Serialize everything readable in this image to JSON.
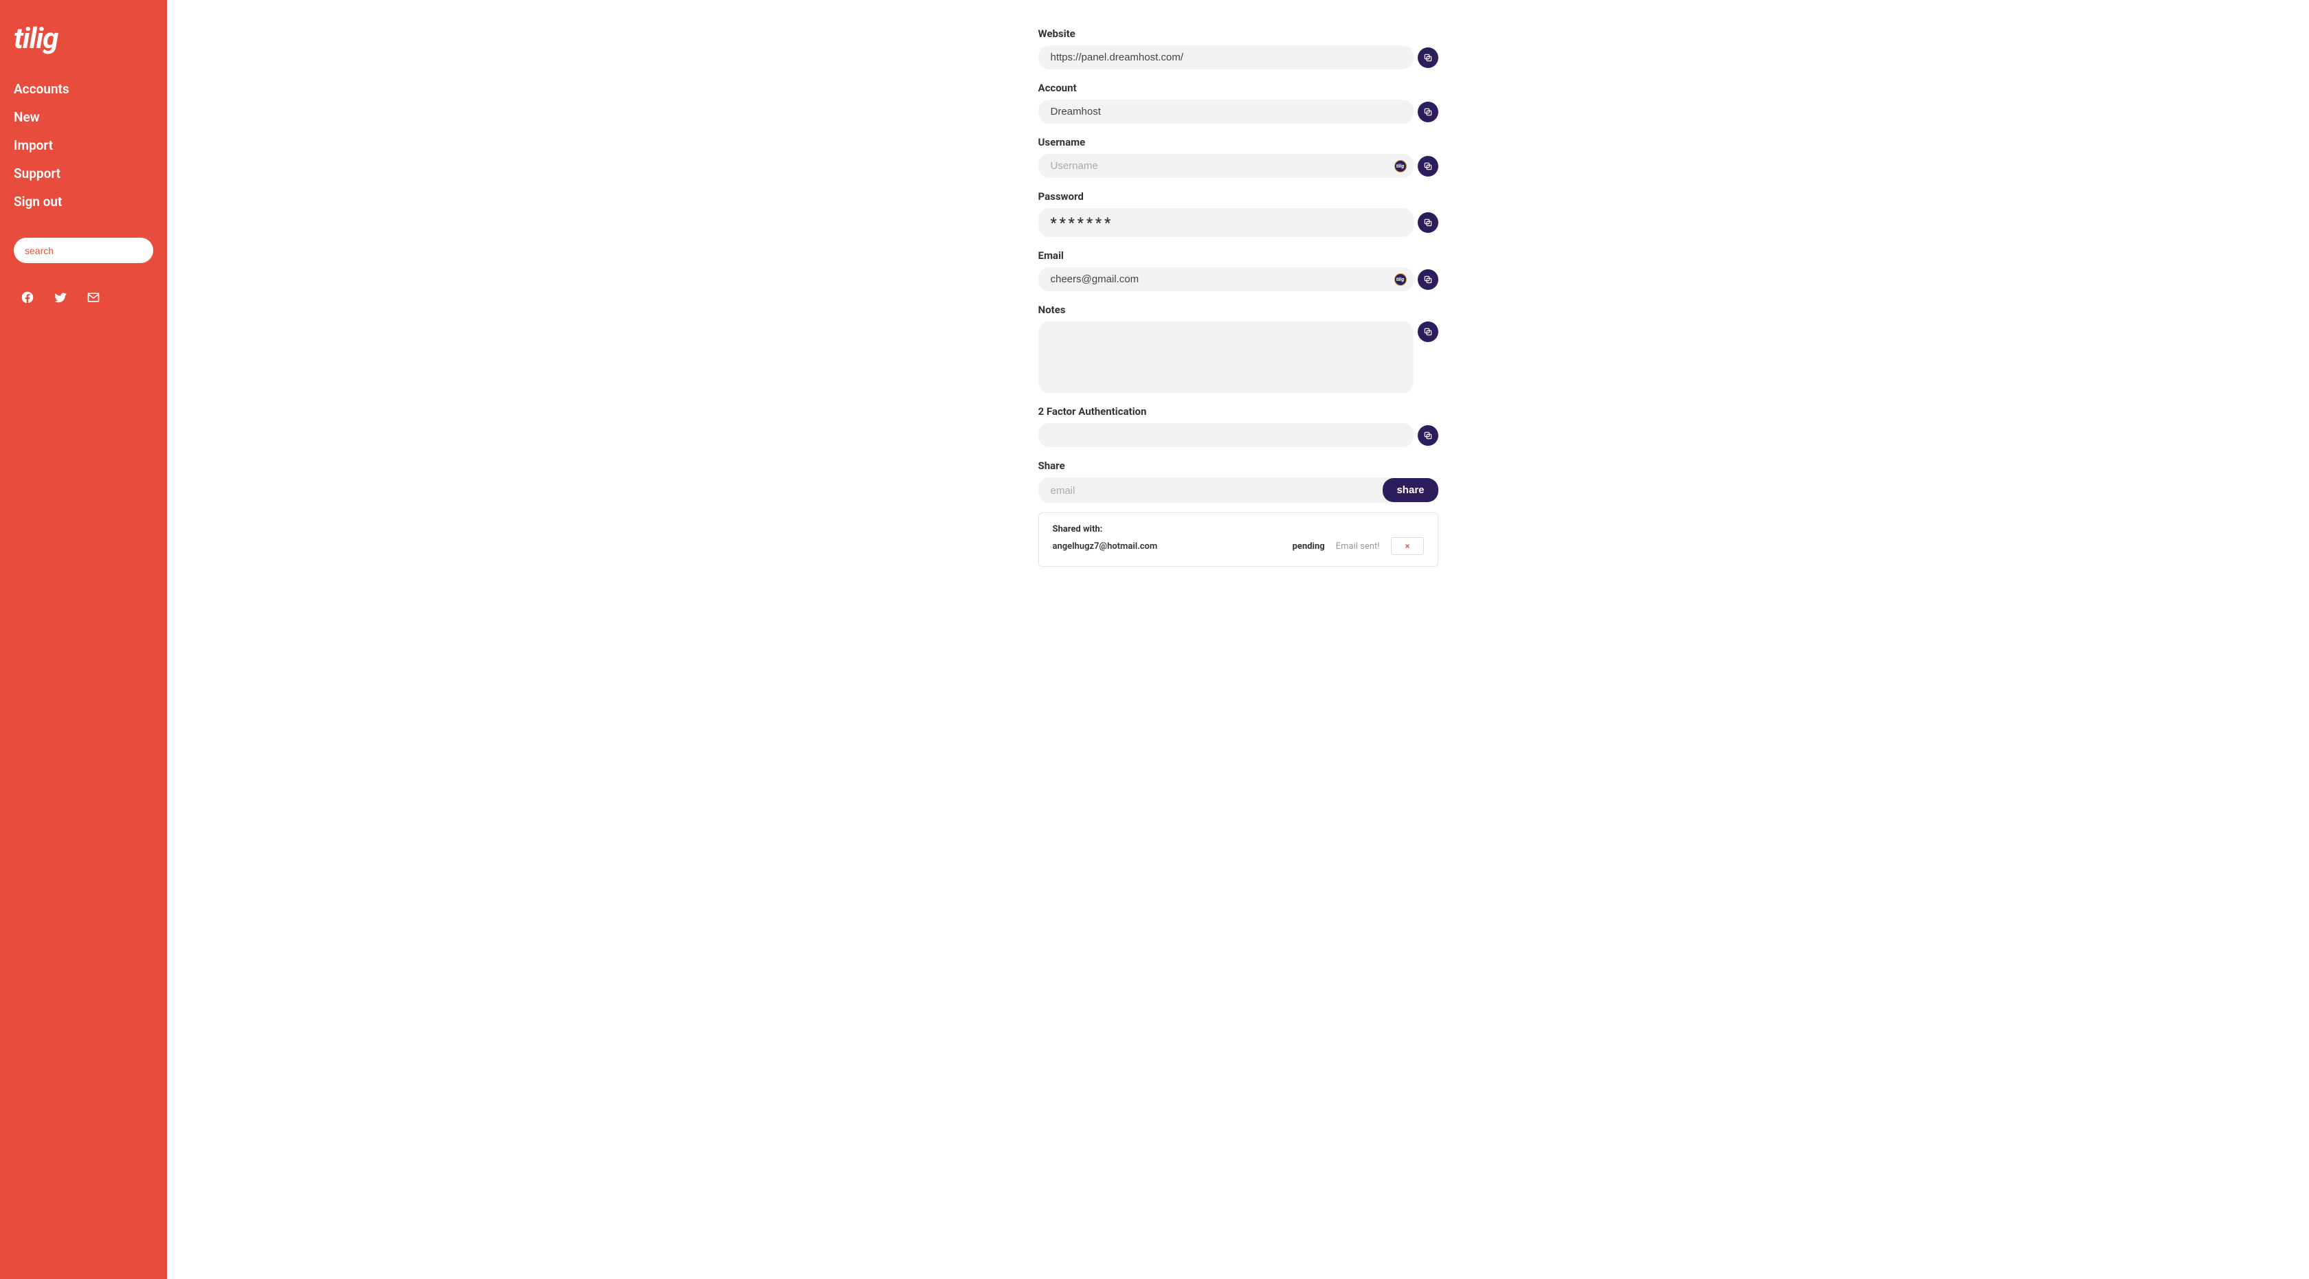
{
  "brand": "tilig",
  "sidebar": {
    "nav": [
      "Accounts",
      "New",
      "Import",
      "Support",
      "Sign out"
    ],
    "search_placeholder": "search"
  },
  "fields": {
    "website": {
      "label": "Website",
      "value": "https://panel.dreamhost.com/"
    },
    "account": {
      "label": "Account",
      "value": "Dreamhost"
    },
    "username": {
      "label": "Username",
      "value": "",
      "placeholder": "Username"
    },
    "password": {
      "label": "Password",
      "value": "*******"
    },
    "email": {
      "label": "Email",
      "value": "cheers@gmail.com"
    },
    "notes": {
      "label": "Notes",
      "value": ""
    },
    "twofa": {
      "label": "2 Factor Authentication",
      "value": ""
    },
    "share": {
      "label": "Share",
      "placeholder": "email",
      "button": "share"
    }
  },
  "shared": {
    "title": "Shared with:",
    "items": [
      {
        "email": "angelhugz7@hotmail.com",
        "status": "pending",
        "message": "Email sent!"
      }
    ]
  },
  "badge_text": "tilig"
}
